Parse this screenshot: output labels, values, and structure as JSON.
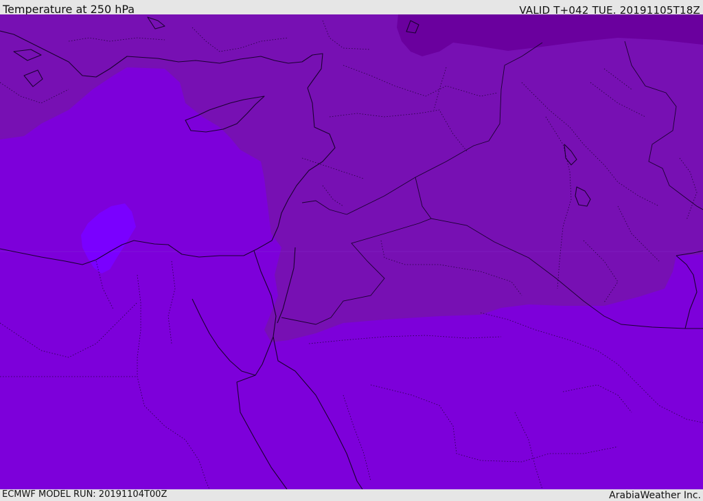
{
  "header": {
    "title": "Temperature at 250 hPa",
    "valid": "VALID T+042 TUE. 20191105T18Z"
  },
  "footer": {
    "model_run": "ECMWF MODEL RUN: 20191104T00Z",
    "credit": "ArabiaWeather Inc."
  },
  "map": {
    "colors": {
      "warm_band": "#7d00da",
      "mid_band": "#7710b3",
      "cold_band": "#6a009e",
      "warm_core": "#7a00ff"
    }
  }
}
